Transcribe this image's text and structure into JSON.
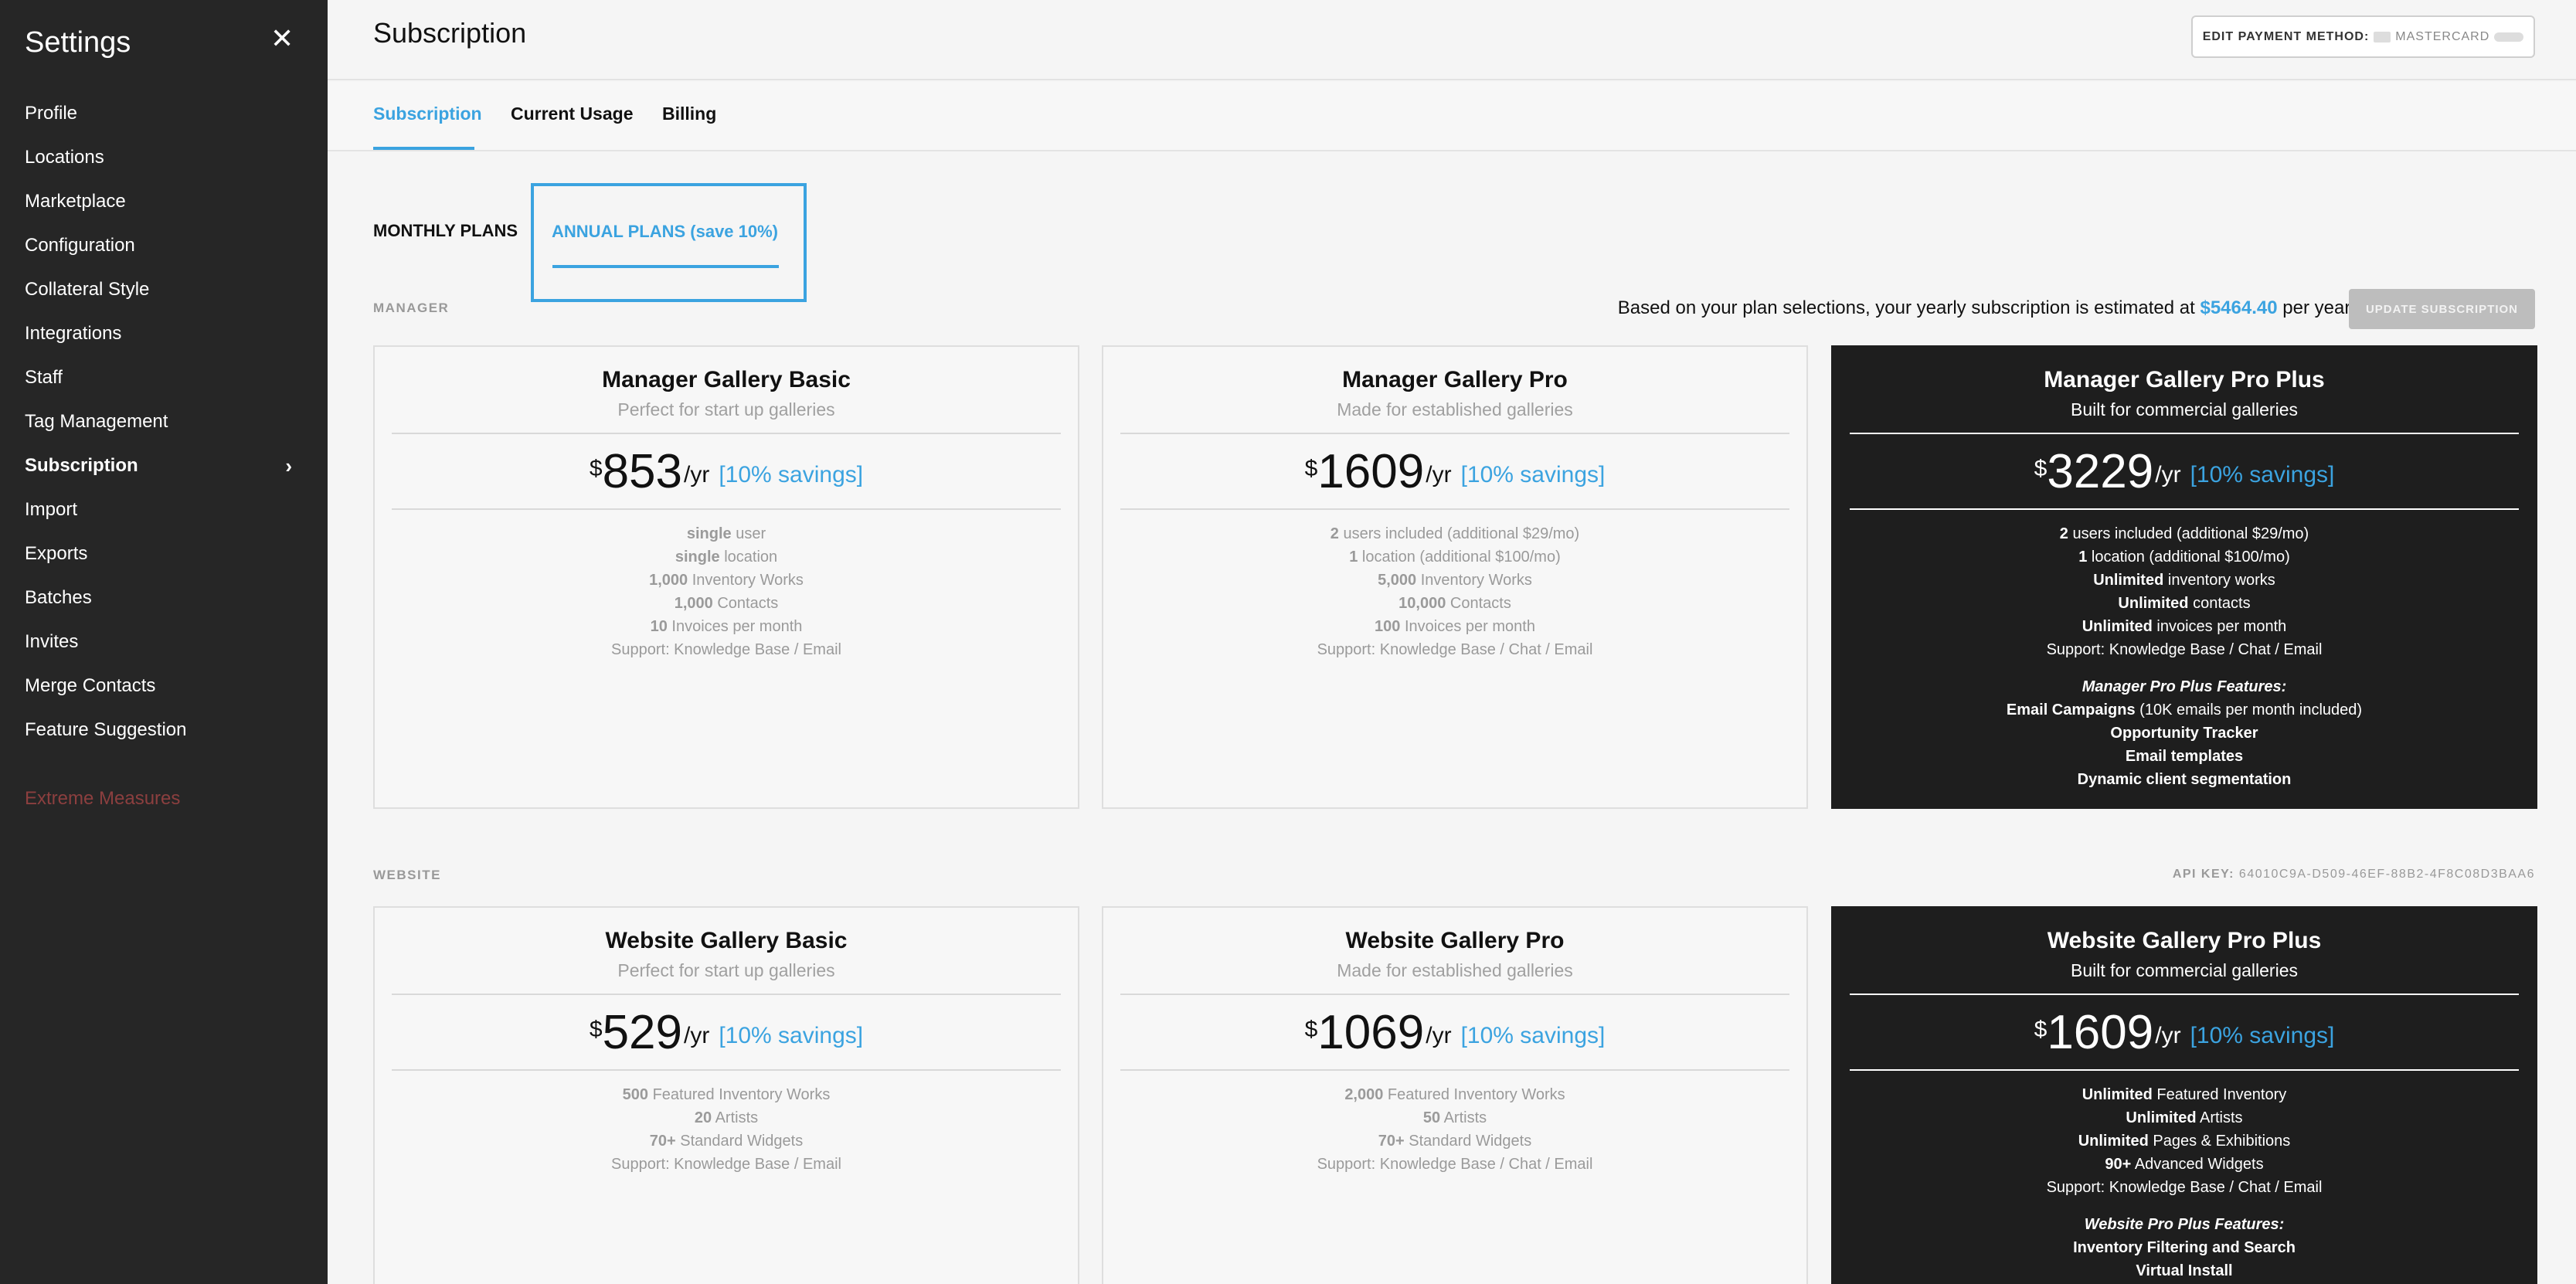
{
  "sidebar": {
    "title": "Settings",
    "close_glyph": "✕",
    "items": [
      {
        "label": "Profile"
      },
      {
        "label": "Locations"
      },
      {
        "label": "Marketplace"
      },
      {
        "label": "Configuration"
      },
      {
        "label": "Collateral Style"
      },
      {
        "label": "Integrations"
      },
      {
        "label": "Staff"
      },
      {
        "label": "Tag Management"
      },
      {
        "label": "Subscription",
        "active": true
      },
      {
        "label": "Import"
      },
      {
        "label": "Exports"
      },
      {
        "label": "Batches"
      },
      {
        "label": "Invites"
      },
      {
        "label": "Merge Contacts"
      },
      {
        "label": "Feature Suggestion"
      }
    ],
    "danger_item": "Extreme Measures",
    "danger_color": "#8c3f3f"
  },
  "header": {
    "title": "Subscription",
    "payment_button_label": "EDIT PAYMENT METHOD:",
    "payment_card_type": "MASTERCARD"
  },
  "tabs": [
    "Subscription",
    "Current Usage",
    "Billing"
  ],
  "plan_tabs": {
    "monthly": "MONTHLY PLANS",
    "annual": "ANNUAL PLANS (save 10%)"
  },
  "accent_color": "#3ba3e0",
  "manager": {
    "section_label": "MANAGER",
    "estimate_prefix": "Based on your plan selections, your yearly subscription is estimated at",
    "estimate_amount": "$5464.40",
    "estimate_suffix": "per year.*",
    "update_button": "UPDATE SUBSCRIPTION"
  },
  "website": {
    "section_label": "WEBSITE",
    "api_key_label": "API KEY:",
    "api_key_value": "64010C9A-D509-46EF-88B2-4F8C08D3BAA6"
  },
  "price_currency": "$",
  "price_period": "/yr",
  "savings_label": "[10% savings]",
  "manager_plans": [
    {
      "name": "Manager Gallery Basic",
      "tagline": "Perfect for start up galleries",
      "price": "853",
      "features": [
        {
          "b": "single",
          "t": " user"
        },
        {
          "b": "single",
          "t": " location"
        },
        {
          "b": "1,000",
          "t": " Inventory Works"
        },
        {
          "b": "1,000",
          "t": " Contacts"
        },
        {
          "b": "10",
          "t": " Invoices per month"
        },
        {
          "b": "",
          "t": "Support: Knowledge Base / Email"
        }
      ]
    },
    {
      "name": "Manager Gallery Pro",
      "tagline": "Made for established galleries",
      "price": "1609",
      "features": [
        {
          "b": "2",
          "t": " users included (additional $29/mo)"
        },
        {
          "b": "1",
          "t": " location (additional $100/mo)"
        },
        {
          "b": "5,000",
          "t": " Inventory Works"
        },
        {
          "b": "10,000",
          "t": " Contacts"
        },
        {
          "b": "100",
          "t": " Invoices per month"
        },
        {
          "b": "",
          "t": "Support: Knowledge Base / Chat / Email"
        }
      ]
    },
    {
      "name": "Manager Gallery Pro Plus",
      "tagline": "Built for commercial galleries",
      "price": "3229",
      "features": [
        {
          "b": "2",
          "t": " users included (additional $29/mo)"
        },
        {
          "b": "1",
          "t": " location (additional $100/mo)"
        },
        {
          "b": "Unlimited",
          "t": " inventory works"
        },
        {
          "b": "Unlimited",
          "t": " contacts"
        },
        {
          "b": "Unlimited",
          "t": " invoices per month"
        },
        {
          "b": "",
          "t": "Support: Knowledge Base / Chat / Email"
        }
      ],
      "extra_title": "Manager Pro Plus Features:",
      "extras": [
        {
          "b": "Email Campaigns",
          "t": " (10K emails per month included)"
        },
        {
          "b": "Opportunity Tracker",
          "t": ""
        },
        {
          "b": "Email templates",
          "t": ""
        },
        {
          "b": "Dynamic client segmentation",
          "t": ""
        }
      ]
    }
  ],
  "website_plans": [
    {
      "name": "Website Gallery Basic",
      "tagline": "Perfect for start up galleries",
      "price": "529",
      "features": [
        {
          "b": "500",
          "t": " Featured Inventory Works"
        },
        {
          "b": "20",
          "t": " Artists"
        },
        {
          "b": "70+",
          "t": " Standard Widgets"
        },
        {
          "b": "",
          "t": "Support: Knowledge Base / Email"
        }
      ]
    },
    {
      "name": "Website Gallery Pro",
      "tagline": "Made for established galleries",
      "price": "1069",
      "features": [
        {
          "b": "2,000",
          "t": " Featured Inventory Works"
        },
        {
          "b": "50",
          "t": " Artists"
        },
        {
          "b": "70+",
          "t": " Standard Widgets"
        },
        {
          "b": "",
          "t": "Support: Knowledge Base / Chat / Email"
        }
      ]
    },
    {
      "name": "Website Gallery Pro Plus",
      "tagline": "Built for commercial galleries",
      "price": "1609",
      "features": [
        {
          "b": "Unlimited",
          "t": " Featured Inventory"
        },
        {
          "b": "Unlimited",
          "t": " Artists"
        },
        {
          "b": "Unlimited",
          "t": " Pages & Exhibitions"
        },
        {
          "b": "90+",
          "t": " Advanced Widgets"
        },
        {
          "b": "",
          "t": "Support: Knowledge Base / Chat / Email"
        }
      ],
      "extra_title": "Website Pro Plus Features:",
      "extras": [
        {
          "b": "Inventory Filtering and Search",
          "t": ""
        },
        {
          "b": "Virtual Install",
          "t": ""
        }
      ]
    }
  ]
}
